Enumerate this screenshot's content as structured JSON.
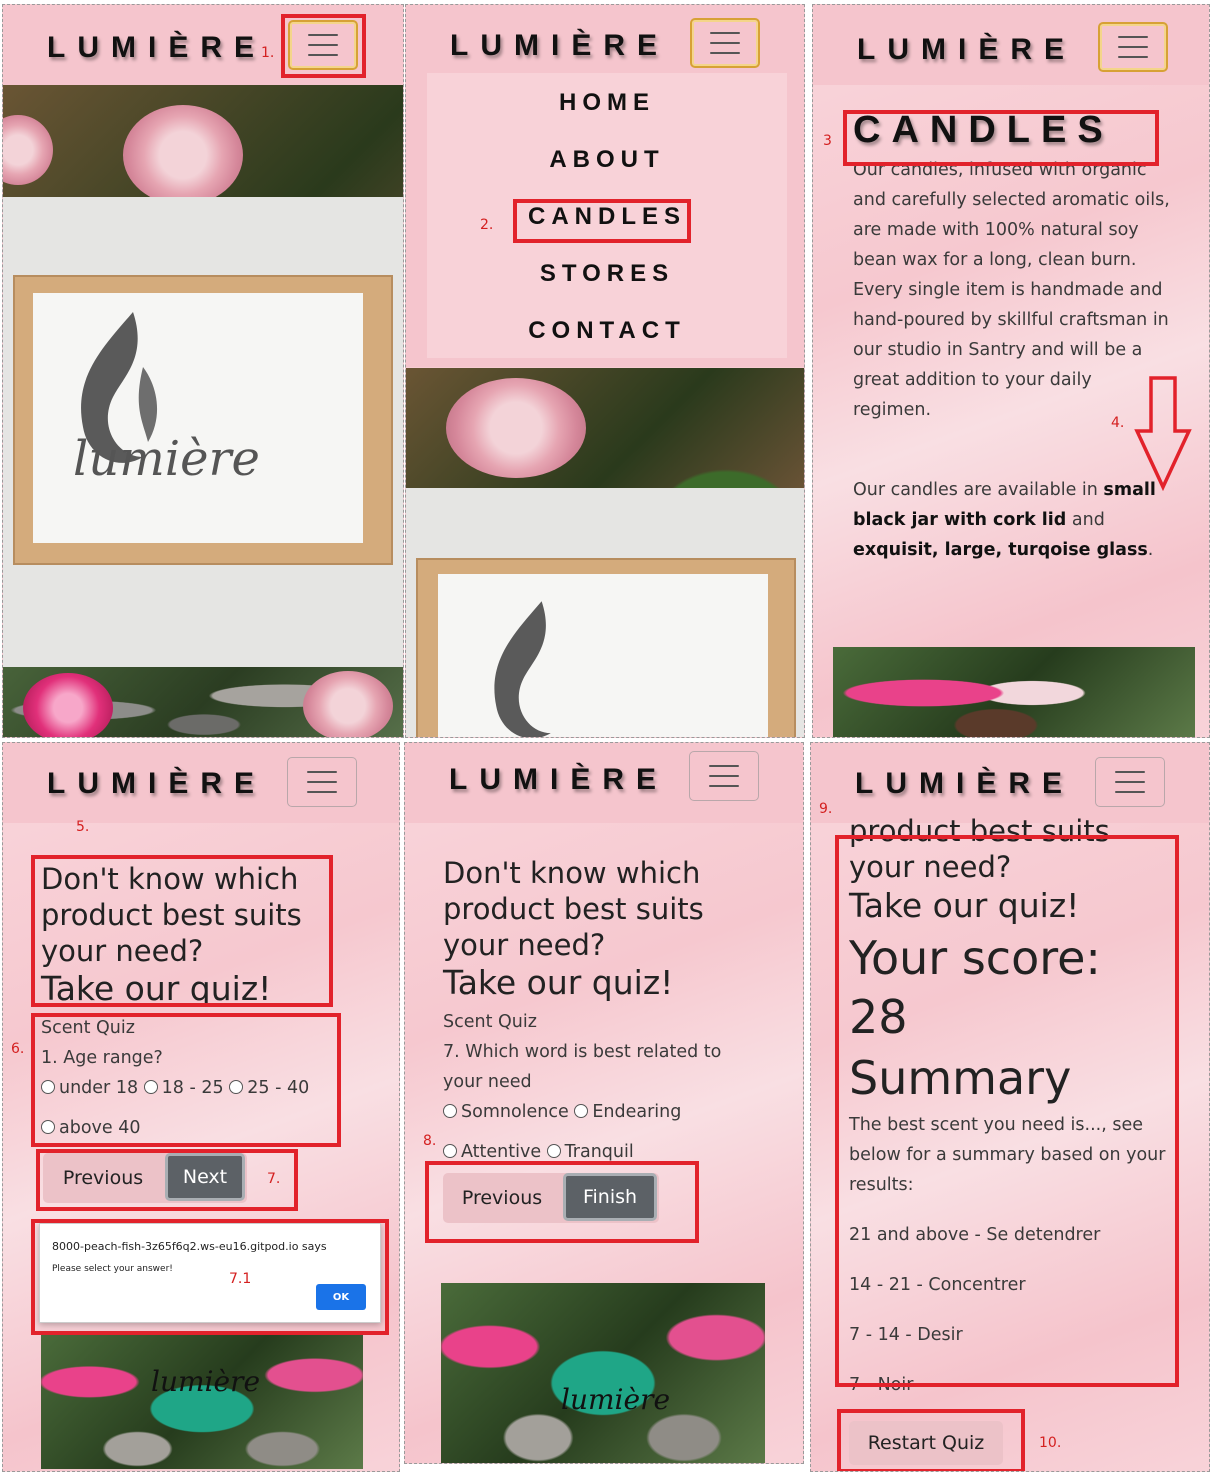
{
  "brand": "LUMIÈRE",
  "annotations": [
    "1.",
    "2.",
    "3",
    "4.",
    "5.",
    "6.",
    "7.",
    "7.1",
    "8.",
    "9.",
    "10."
  ],
  "menu_items": [
    "HOME",
    "ABOUT",
    "CANDLES",
    "STORES",
    "CONTACT"
  ],
  "logo_script": "lumière",
  "candles": {
    "title": "CANDLES",
    "p1": [
      "Our candles, infused with organic",
      "and carefully selected aromatic oils,",
      "are made with 100% natural soy",
      "bean wax for a long, clean burn.",
      "Every single item is handmade and",
      "hand-poured by skillful craftsman in",
      "our studio in Santry and will be a",
      "great addition to your daily",
      "regimen."
    ],
    "p2_a": "Our candles are available in ",
    "p2_b": "small",
    "p2_c": "black jar with cork lid",
    "p2_d": " and",
    "p2_e": "exquisit, large, turqoise glass",
    "p2_f": "."
  },
  "quiz": {
    "heading_lines": [
      "Don't know which",
      "product best suits",
      "your need?"
    ],
    "cta": "Take our quiz!",
    "quiz_title": "Scent Quiz",
    "q1": {
      "question": "1. Age range?",
      "options": [
        "under 18",
        "18 - 25",
        "25 - 40",
        "above 40"
      ]
    },
    "q7": {
      "question_lines": [
        "7. Which word is best related to",
        "your need"
      ],
      "options": [
        "Somnolence",
        "Endearing",
        "Attentive",
        "Tranquil"
      ]
    },
    "prev_label": "Previous",
    "next_label": "Next",
    "finish_label": "Finish",
    "alert": {
      "origin": "8000-peach-fish-3z65f6q2.ws-eu16.gitpod.io says",
      "message": "Please select your answer!",
      "ok": "OK"
    }
  },
  "results": {
    "top_line": "product best suits",
    "need_line": "your need?",
    "cta": "Take our quiz!",
    "score_label": "Your score:",
    "score": "28",
    "summary_label": "Summary",
    "intro_lines": [
      "The best scent you need is..., see",
      "below for a summary based on your",
      "results:"
    ],
    "tiers": [
      "21 and above - Se detendrer",
      "14 - 21 - Concentrer",
      "7 - 14 - Desir",
      "7 - Noir"
    ],
    "restart_label": "Restart Quiz"
  },
  "colors": {
    "accent_red": "#e2222b",
    "navbar_pink": "#f5c5cd",
    "button_dark": "#5c6166",
    "focus_gold": "#d7a135"
  },
  "icons": [
    "hamburger-menu-icon",
    "down-arrow-icon",
    "radio-icon"
  ]
}
